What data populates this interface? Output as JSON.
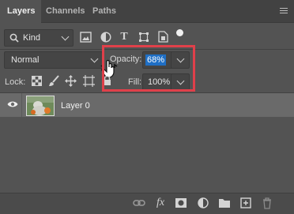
{
  "tabs": [
    {
      "label": "Layers",
      "active": true
    },
    {
      "label": "Channels",
      "active": false
    },
    {
      "label": "Paths",
      "active": false
    }
  ],
  "filter": {
    "kind_label": "Kind"
  },
  "blend": {
    "mode": "Normal",
    "opacity_label": "Opacity:",
    "opacity_value": "68%"
  },
  "lock": {
    "label": "Lock:",
    "fill_label": "Fill:",
    "fill_value": "100%"
  },
  "layers": [
    {
      "name": "Layer 0",
      "visible": true
    }
  ],
  "colors": {
    "panel_bg": "#535353",
    "tab_bg": "#424242",
    "selected_layer": "#6a6a6a",
    "opacity_highlight": "#1f6fc5",
    "callout_border": "#e0404a"
  }
}
